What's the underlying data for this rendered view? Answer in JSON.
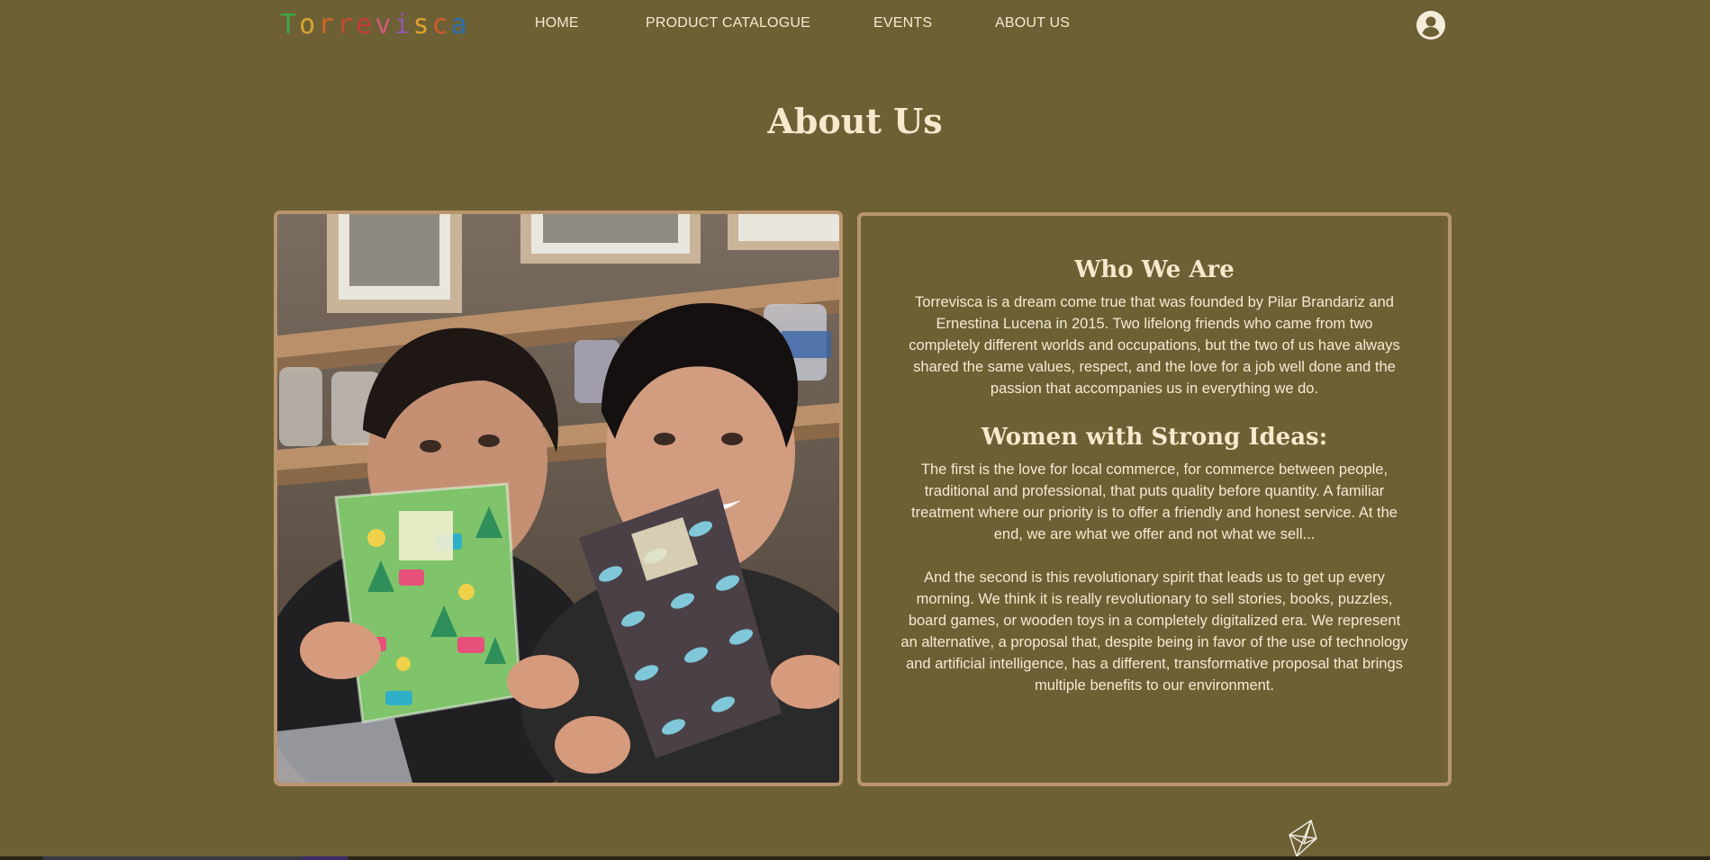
{
  "header": {
    "logo_letters": [
      {
        "char": "T",
        "color": "#3ea64a"
      },
      {
        "char": "o",
        "color": "#d8a532"
      },
      {
        "char": "r",
        "color": "#d2672a"
      },
      {
        "char": "r",
        "color": "#c44a34"
      },
      {
        "char": "e",
        "color": "#c83b3b"
      },
      {
        "char": "v",
        "color": "#cf5a7a"
      },
      {
        "char": "i",
        "color": "#8e5aa8"
      },
      {
        "char": "s",
        "color": "#e0a22f"
      },
      {
        "char": "c",
        "color": "#d25b2b"
      },
      {
        "char": "a",
        "color": "#2a6fb0"
      }
    ],
    "nav": [
      {
        "label": "HOME"
      },
      {
        "label": "PRODUCT CATALOGUE"
      },
      {
        "label": "EVENTS"
      },
      {
        "label": "ABOUT US"
      }
    ],
    "account_icon": "account-circle-icon"
  },
  "page": {
    "title": "About Us"
  },
  "about": {
    "who_heading": "Who We Are",
    "who_text": "Torrevisca is a dream come true that was founded by Pilar Brandariz and Ernestina Lucena in 2015. Two lifelong friends who came from two completely different worlds and occupations, but the two of us have always shared the same values, respect, and the love for a job well done and the passion that accompanies us in everything we do.",
    "ideas_heading": "Women with Strong Ideas:",
    "ideas_text_1": "The first is the love for local commerce, for commerce between people, traditional and professional, that puts quality before quantity. A familiar treatment where our priority is to offer a friendly and honest service. At the end, we are what we offer and not what we sell...",
    "ideas_text_2": "And the second is this revolutionary spirit that leads us to get up every morning. We think it is really revolutionary to sell stories, books, puzzles, board games, or wooden toys in a completely digitalized era. We represent an alternative, a proposal that, despite being in favor of the use of technology and artificial intelligence, has a different, transformative proposal that brings multiple benefits to our environment."
  },
  "colors": {
    "background": "#6c6034",
    "frame_border": "#b8956c",
    "text": "#f5ead4"
  },
  "icons": {
    "decorative": "geometric-gem-icon"
  }
}
